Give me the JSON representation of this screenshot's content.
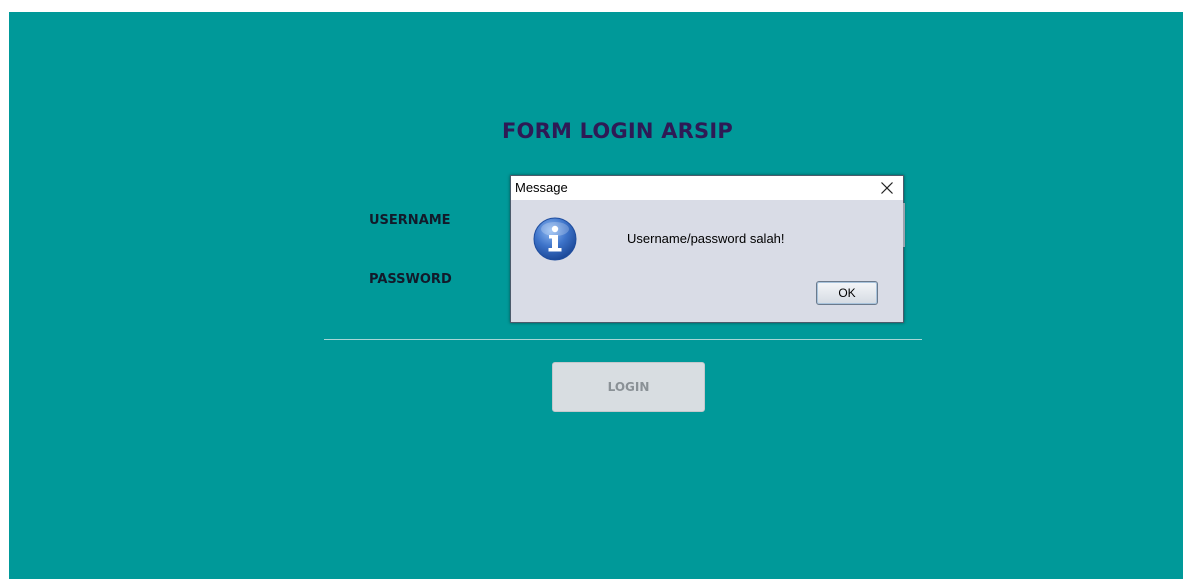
{
  "form": {
    "title": "FORM LOGIN ARSIP",
    "username_label": "USERNAME",
    "password_label": "PASSWORD",
    "login_button": "LOGIN"
  },
  "dialog": {
    "title": "Message",
    "message": "Username/password salah!",
    "ok_button": "OK",
    "icon": "info-icon"
  },
  "colors": {
    "background": "#009999",
    "title_text": "#2e1a55",
    "dialog_background": "#d9dce6"
  }
}
